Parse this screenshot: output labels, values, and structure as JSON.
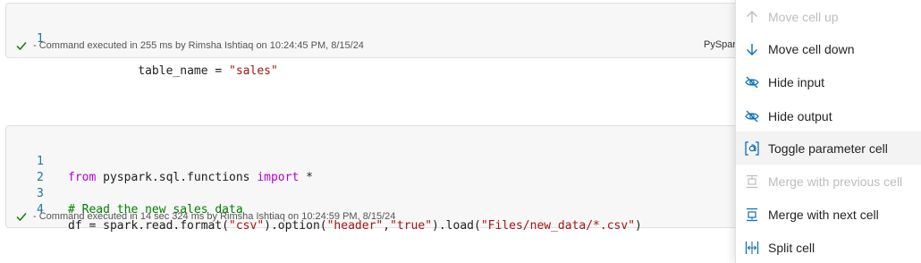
{
  "cells": [
    {
      "lines": [
        {
          "num": "1",
          "tokens": [
            {
              "cls": "txt",
              "text": "table_name = "
            },
            {
              "cls": "str",
              "text": "\"sales\""
            }
          ]
        }
      ],
      "status": "- Command executed in 255 ms by Rimsha Ishtiaq on 10:24:45 PM, 8/15/24",
      "language": "PySpark"
    },
    {
      "lines": [
        {
          "num": "1",
          "tokens": [
            {
              "cls": "kw",
              "text": "from"
            },
            {
              "cls": "txt",
              "text": " pyspark.sql.functions "
            },
            {
              "cls": "kw",
              "text": "import"
            },
            {
              "cls": "txt",
              "text": " *"
            }
          ]
        },
        {
          "num": "2",
          "tokens": []
        },
        {
          "num": "3",
          "tokens": [
            {
              "cls": "cmt",
              "text": "# Read the new sales data"
            }
          ]
        },
        {
          "num": "4",
          "tokens": [
            {
              "cls": "txt",
              "text": "df = spark.read.format("
            },
            {
              "cls": "str",
              "text": "\"csv\""
            },
            {
              "cls": "txt",
              "text": ").option("
            },
            {
              "cls": "str",
              "text": "\"header\""
            },
            {
              "cls": "txt",
              "text": ","
            },
            {
              "cls": "str",
              "text": "\"true\""
            },
            {
              "cls": "txt",
              "text": ").load("
            },
            {
              "cls": "str",
              "text": "\"Files/new_data/*.csv\""
            },
            {
              "cls": "txt",
              "text": ")"
            }
          ]
        }
      ],
      "status": "- Command executed in 14 sec 324 ms by Rimsha Ishtiaq on 10:24:59 PM, 8/15/24"
    }
  ],
  "menu": {
    "items": [
      {
        "label": "Move cell up",
        "icon": "arrow-up-icon",
        "enabled": false
      },
      {
        "label": "Move cell down",
        "icon": "arrow-down-icon",
        "enabled": true
      },
      {
        "label": "Hide input",
        "icon": "eye-off-icon",
        "enabled": true
      },
      {
        "label": "Hide output",
        "icon": "eye-off-icon",
        "enabled": true
      },
      {
        "label": "Toggle parameter cell",
        "icon": "parameter-icon",
        "enabled": true,
        "hovered": true
      },
      {
        "label": "Merge with previous cell",
        "icon": "merge-up-icon",
        "enabled": false
      },
      {
        "label": "Merge with next cell",
        "icon": "merge-down-icon",
        "enabled": true
      },
      {
        "label": "Split cell",
        "icon": "split-icon",
        "enabled": true
      }
    ]
  },
  "colors": {
    "accent": "#0f6cbd",
    "success": "#107c10",
    "keyword": "#af00db",
    "string": "#a31515",
    "comment": "#008000",
    "line_number": "#237893"
  }
}
